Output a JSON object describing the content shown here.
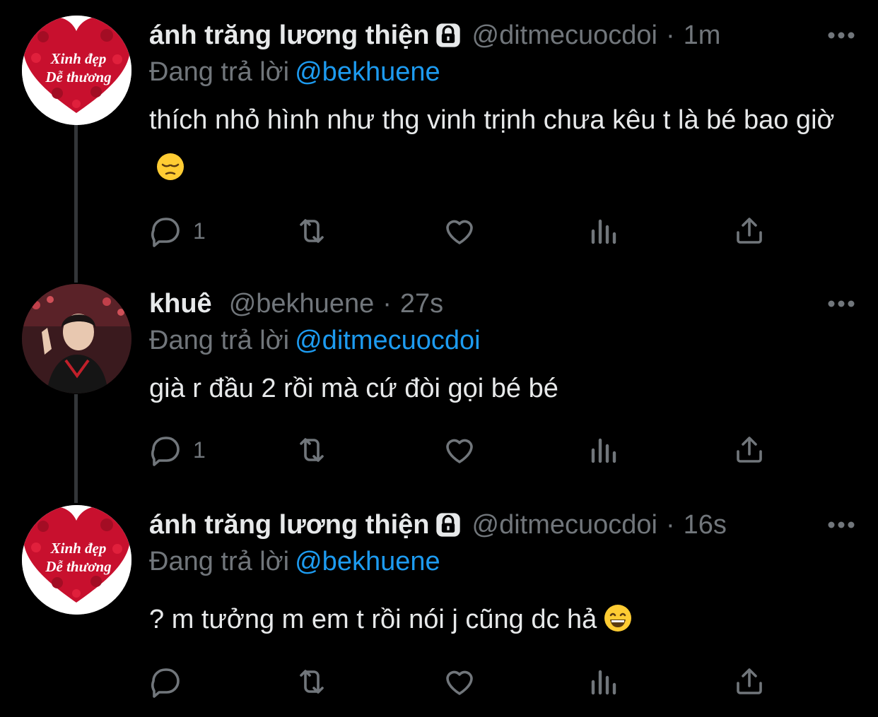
{
  "tweets": [
    {
      "name": "ánh trăng lương thiện",
      "handle": "@ditmecuocdoi",
      "separator": "·",
      "time": "1m",
      "reply_label": "Đang trả lời",
      "reply_to": "@bekhuene",
      "text": "thích nhỏ hình như thg vinh trịnh chưa kêu t là bé bao giờ",
      "emoji": "pensive-face-emoji",
      "avatar_text_1": "Xinh đẹp",
      "avatar_text_2": "Dễ thương",
      "reply_count": "1",
      "locked": true
    },
    {
      "name": "khuê",
      "handle": "@bekhuene",
      "separator": "·",
      "time": "27s",
      "reply_label": "Đang trả lời",
      "reply_to": "@ditmecuocdoi",
      "text": "già r đầu 2 rồi mà cứ đòi gọi bé bé",
      "reply_count": "1",
      "locked": false
    },
    {
      "name": "ánh trăng lương thiện",
      "handle": "@ditmecuocdoi",
      "separator": "·",
      "time": "16s",
      "reply_label": "Đang trả lời",
      "reply_to": "@bekhuene",
      "text": "? m tưởng m em t rồi nói j cũng dc hả",
      "emoji": "grinning-face-emoji",
      "avatar_text_1": "Xinh đẹp",
      "avatar_text_2": "Dễ thương",
      "reply_count": "",
      "locked": true
    }
  ],
  "icons": {
    "reply": "reply-icon",
    "retweet": "retweet-icon",
    "like": "like-heart-icon",
    "views": "views-chart-icon",
    "share": "share-icon",
    "more": "more-dots-icon",
    "lock": "lock-icon"
  },
  "colors": {
    "background": "#000000",
    "text_primary": "#e7e9ea",
    "text_secondary": "#71767b",
    "link": "#1d9bf0",
    "thread_line": "#333639",
    "avatar_heart": "#c8102e"
  }
}
